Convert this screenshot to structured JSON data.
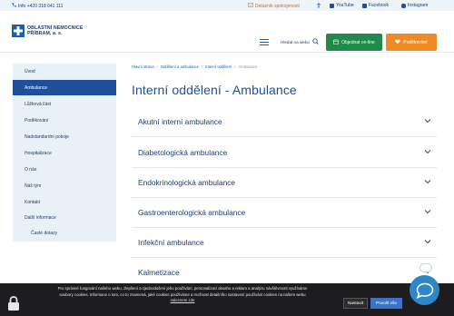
{
  "topbar": {
    "phone": "Info +420 318 641 111",
    "survey": "Dotazník spokojenosti",
    "youtube": "YouTube",
    "facebook": "Facebook",
    "instagram": "Instagram"
  },
  "header": {
    "logo_line1": "OBLASTNÍ NEMOCNICE",
    "logo_line2": "PŘÍBRAM, a. s.",
    "search_label": "Hledat na webu",
    "order_online": "Objednat on-line",
    "thanks": "Poděkování"
  },
  "sidebar": {
    "items": [
      {
        "label": "Úvod"
      },
      {
        "label": "Ambulance"
      },
      {
        "label": "Lůžková část"
      },
      {
        "label": "Poděkování"
      },
      {
        "label": "Nadstandardní pokoje"
      },
      {
        "label": "Hospitalizace"
      },
      {
        "label": "O nás"
      },
      {
        "label": "Náš tým"
      },
      {
        "label": "Kontakt"
      },
      {
        "label": "Další informace"
      },
      {
        "label": "Časté dotazy"
      }
    ]
  },
  "breadcrumb": {
    "items": [
      "Hlavní strana",
      "Oddělení a ambulance",
      "Interní oddělení",
      "Ambulance"
    ]
  },
  "page_title": "Interní oddělení - Ambulance",
  "accordion": {
    "items": [
      {
        "label": "Akutní interní ambulance"
      },
      {
        "label": "Diabetologická ambulance"
      },
      {
        "label": "Endokrinologická ambulance"
      },
      {
        "label": "Gastroenterologická ambulance"
      },
      {
        "label": "Infekční ambulance"
      },
      {
        "label": "Kalmetizace"
      }
    ]
  },
  "cookie": {
    "line1": "Pro správné fungování našeho webu, zlepšení a zjednodušení jeho používání, personalizaci obsahu a reklam a analýzu návštěvnosti využíváme",
    "line2": "soubory cookies. Informace o tom, co to znamená, jaké cookies používáme a možnost detailního nastavení používání cookies na našem webu",
    "link": "naleznete zde",
    "settings": "Nastavit",
    "accept": "Povolit vše"
  },
  "colors": {
    "primary": "#1d4f9a",
    "green": "#1f8a4a",
    "orange": "#f08a24",
    "sidebar_bg": "#e9f1f8",
    "chat": "#2d86c6"
  }
}
